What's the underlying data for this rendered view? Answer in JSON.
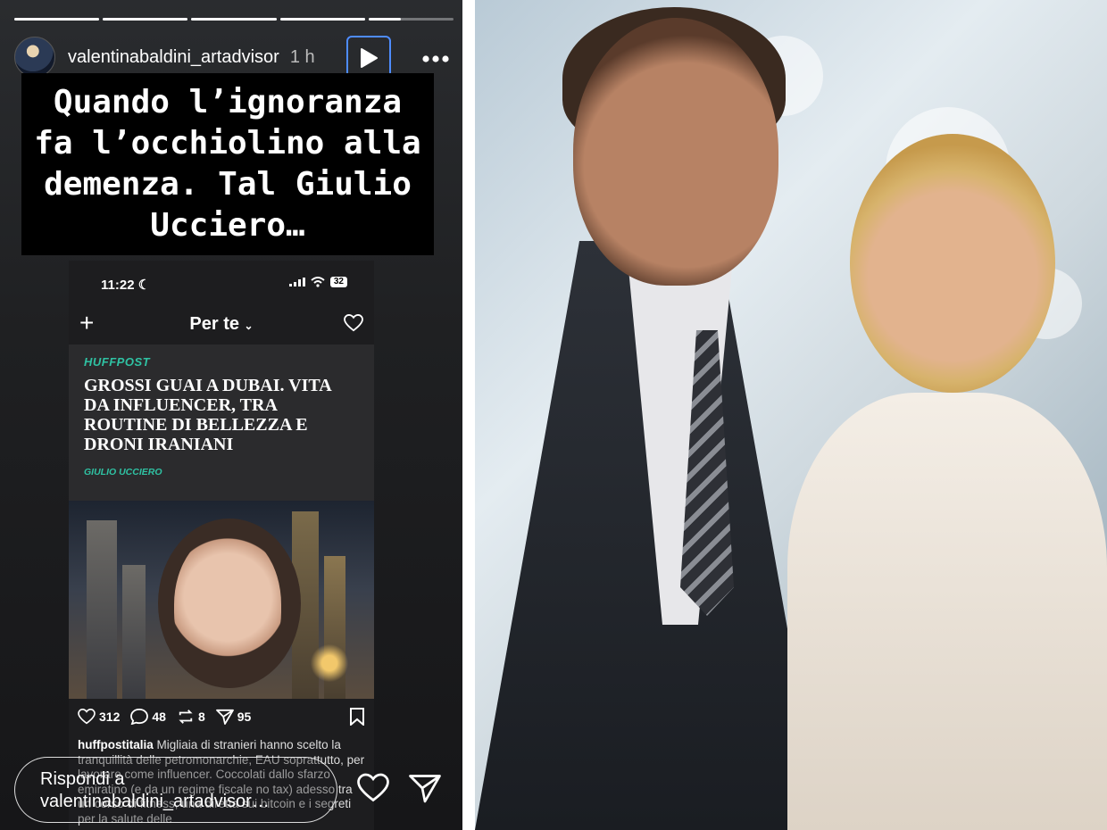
{
  "story": {
    "progress": [
      1,
      1,
      1,
      1,
      0.38
    ],
    "username": "valentinabaldini_artadvisor",
    "time": "1 h",
    "play_icon": "play-icon",
    "more_icon": "more-dots-icon",
    "caption": "Quando l’ignoranza fa l’occhiolino alla demenza. Tal Giulio Ucciero…",
    "screenshot": {
      "clock": "11:22",
      "battery": "32",
      "feed_title": "Per te",
      "article": {
        "brand": "HUFFPOST",
        "headline": "GROSSI GUAI A DUBAI. VITA DA INFLUENCER, TRA ROUTINE DI BELLEZZA E DRONI IRANIANI",
        "author": "GIULIO UCCIERO"
      },
      "stats": {
        "likes": "312",
        "comments": "48",
        "reposts": "8",
        "shares": "95"
      },
      "post_author": "huffpostitalia",
      "post_text": "Migliaia di stranieri hanno scelto la tranquillità delle petromonarchie, EAU soprattutto, per lavorare come influencer. Coccolati dallo sfarzo emiratino (e da un regime fiscale no tax) adesso tra un corso di fitness, una diretta sui bitcoin e i segreti per la salute delle"
    },
    "reply_placeholder": "Rispondi a valentinabaldini_artadvisor…"
  },
  "colors": {
    "accent_blue": "#4e8cff",
    "huffpost_green": "#2fc2a3"
  }
}
